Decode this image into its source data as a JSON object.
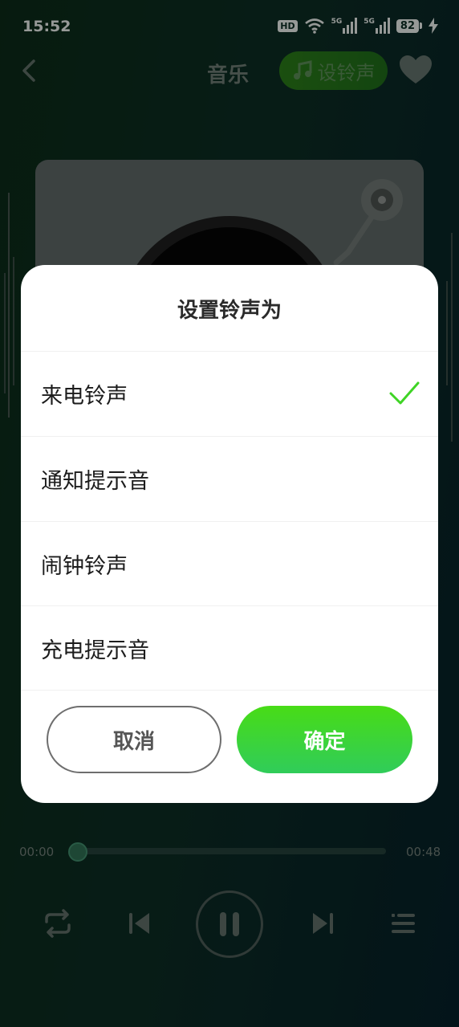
{
  "status": {
    "time": "15:52",
    "hd": "HD",
    "network_1": "5G",
    "network_2": "5G",
    "battery": "82"
  },
  "header": {
    "title": "音乐",
    "ringtone_button": "设铃声"
  },
  "dialog": {
    "title": "设置铃声为",
    "options": [
      {
        "label": "来电铃声",
        "selected": true
      },
      {
        "label": "通知提示音",
        "selected": false
      },
      {
        "label": "闹钟铃声",
        "selected": false
      },
      {
        "label": "充电提示音",
        "selected": false
      }
    ],
    "cancel_label": "取消",
    "confirm_label": "确定",
    "accent_color": "#3fd425"
  },
  "player": {
    "current_time": "00:00",
    "total_time": "00:48",
    "progress": 0
  },
  "icons": {
    "back": "chevron-left-icon",
    "ringtone": "music-note-icon",
    "favorite": "heart-icon",
    "repeat": "repeat-icon",
    "previous": "skip-previous-icon",
    "pause": "pause-icon",
    "next": "skip-next-icon",
    "playlist": "playlist-icon",
    "check": "check-icon"
  }
}
